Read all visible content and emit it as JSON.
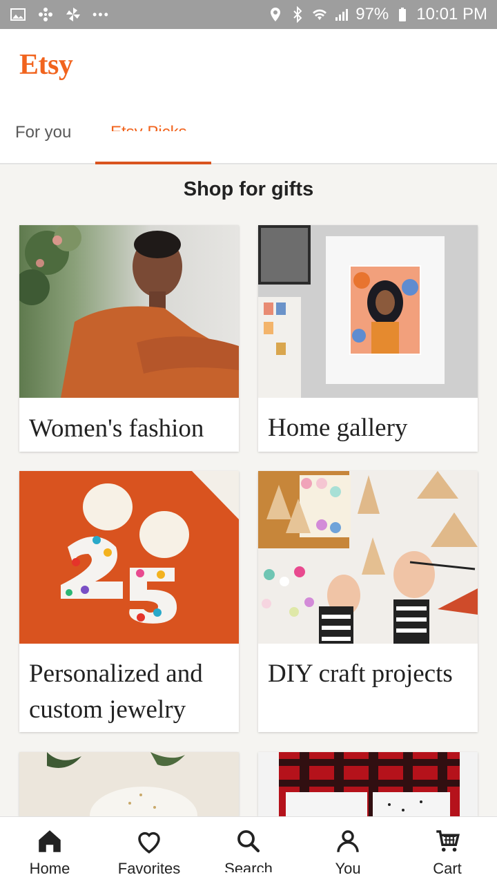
{
  "status_bar": {
    "left_icons": [
      "image-icon",
      "pinwheel-icon",
      "fan-icon",
      "more-icon"
    ],
    "more_text": "•••",
    "right_icons": [
      "location-icon",
      "bluetooth-icon",
      "wifi-icon",
      "signal-icon",
      "battery-icon"
    ],
    "battery": "97%",
    "time": "10:01 PM"
  },
  "header": {
    "logo": "Etsy",
    "tabs": [
      {
        "label": "For you",
        "active": false
      },
      {
        "label": "Etsy Picks",
        "active": true
      }
    ]
  },
  "section": {
    "title": "Shop for gifts"
  },
  "cards": [
    {
      "label": "Women's fashion",
      "image": "woman-in-orange-dress"
    },
    {
      "label": "Home gallery",
      "image": "framed-art-print"
    },
    {
      "label": "Personalized and custom jewelry",
      "image": "number-earrings"
    },
    {
      "label": "DIY craft projects",
      "image": "painting-wooden-ornaments"
    },
    {
      "label": "",
      "image": "white-ceramic-bowl"
    },
    {
      "label": "",
      "image": "plaid-enamel-mugs"
    }
  ],
  "bottom_nav": [
    {
      "label": "Home",
      "icon": "home-icon"
    },
    {
      "label": "Favorites",
      "icon": "heart-icon"
    },
    {
      "label": "Search",
      "icon": "search-icon"
    },
    {
      "label": "You",
      "icon": "user-icon"
    },
    {
      "label": "Cart",
      "icon": "cart-icon"
    }
  ],
  "colors": {
    "brand": "#f1641e",
    "tab_indicator": "#d9541f",
    "status_bar": "#9e9e9e"
  }
}
